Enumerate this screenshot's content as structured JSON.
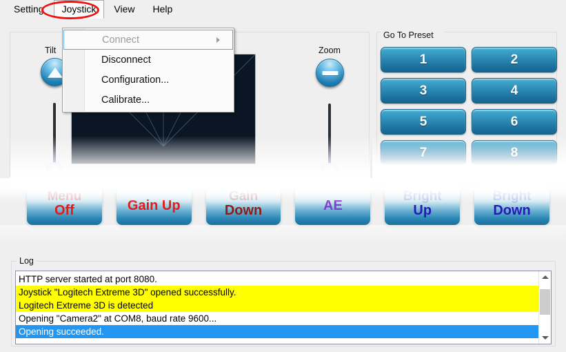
{
  "window": {
    "background_color": "#efefef",
    "accent_color": "#2a87b4",
    "annotation_color": "#ee1111"
  },
  "menubar": {
    "items": [
      {
        "label": "Setting",
        "state": "normal"
      },
      {
        "label": "Joystick",
        "state": "open"
      },
      {
        "label": "View",
        "state": "normal"
      },
      {
        "label": "Help",
        "state": "normal"
      }
    ]
  },
  "dropdown": {
    "owner": "Joystick",
    "items": [
      {
        "label": "Connect",
        "disabled": true,
        "has_submenu": true,
        "highlighted": true
      },
      {
        "label": "Disconnect",
        "disabled": false,
        "has_submenu": false,
        "highlighted": false
      },
      {
        "label": "Configuration...",
        "disabled": false,
        "has_submenu": false,
        "highlighted": false
      },
      {
        "label": "Calibrate...",
        "disabled": false,
        "has_submenu": false,
        "highlighted": false
      }
    ]
  },
  "controls": {
    "tilt": {
      "label": "Tilt",
      "button_icon": "triangle-up-icon"
    },
    "zoom": {
      "label": "Zoom",
      "button_icon": "minus-icon"
    },
    "video_panel": {
      "background_color": "#0a1624"
    }
  },
  "preset": {
    "title": "Go To Preset",
    "buttons": [
      "1",
      "2",
      "3",
      "4",
      "5",
      "6",
      "7",
      "8"
    ]
  },
  "actions": [
    {
      "line1": "Menu",
      "line2": "Off",
      "color_class": "ac-red"
    },
    {
      "line1": "Gain Up",
      "line2": "",
      "color_class": "ac-red"
    },
    {
      "line1": "Gain",
      "line2": "Down",
      "color_class": "ac-dred"
    },
    {
      "line1": "AE",
      "line2": "",
      "color_class": "ac-purple"
    },
    {
      "line1": "Bright",
      "line2": "Up",
      "color_class": "ac-blue"
    },
    {
      "line1": "Bright",
      "line2": "Down",
      "color_class": "ac-blue"
    }
  ],
  "log": {
    "title": "Log",
    "lines": [
      {
        "text": "HTTP server started at port 8080.",
        "highlight": "none"
      },
      {
        "text": "Joystick \"Logitech Extreme 3D\" opened successfully.",
        "highlight": "yellow"
      },
      {
        "text": "Logitech Extreme 3D is detected",
        "highlight": "yellow"
      },
      {
        "text": "Opening \"Camera2\" at COM8, baud rate 9600...",
        "highlight": "none"
      },
      {
        "text": "Opening succeeded.",
        "highlight": "blue"
      }
    ],
    "scrollbar": {
      "up_icon": "chevron-up-icon",
      "down_icon": "chevron-down-icon"
    }
  }
}
